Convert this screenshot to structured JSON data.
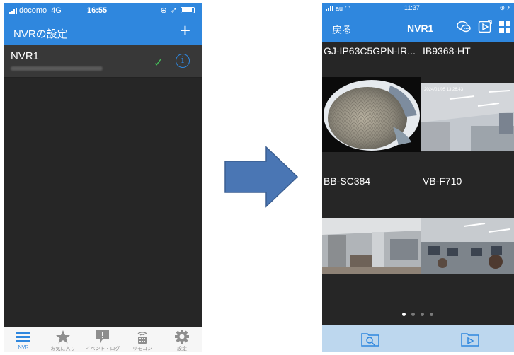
{
  "left_phone": {
    "status": {
      "carrier": "docomo",
      "network": "4G",
      "time": "16:55"
    },
    "header": {
      "title": "NVRの設定",
      "add_icon": "plus-icon"
    },
    "list": [
      {
        "name": "NVR1",
        "status_icon": "check-icon",
        "info_icon": "info-icon"
      }
    ],
    "tabbar": [
      {
        "label": "NVR",
        "icon": "list-icon",
        "active": true
      },
      {
        "label": "お気に入り",
        "icon": "star-icon",
        "active": false
      },
      {
        "label": "イベント・ログ",
        "icon": "event-log-icon",
        "active": false
      },
      {
        "label": "リモコン",
        "icon": "remote-icon",
        "active": false
      },
      {
        "label": "設定",
        "icon": "gear-icon",
        "active": false
      }
    ]
  },
  "right_phone": {
    "status": {
      "carrier": "au",
      "time": "11:37"
    },
    "header": {
      "back_label": "戻る",
      "title": "NVR1"
    },
    "cameras": [
      {
        "label": "GJ-IP63C5GPN-IR...",
        "overlay": ""
      },
      {
        "label": "IB9368-HT",
        "overlay": "2024/01/05 13:26:43"
      },
      {
        "label": "BB-SC384",
        "overlay": ""
      },
      {
        "label": "VB-F710",
        "overlay": ""
      }
    ],
    "pager": {
      "pages": 4,
      "current": 1
    },
    "bottom_bar": {
      "left_icon": "search-folder-icon",
      "right_icon": "playback-folder-icon"
    }
  },
  "colors": {
    "accent": "#2f87de",
    "dark_bg": "#262626",
    "row_bg": "#383838",
    "check": "#45c25a",
    "bottom_bar": "#bdd7ee",
    "arrow": "#4a76b4"
  }
}
